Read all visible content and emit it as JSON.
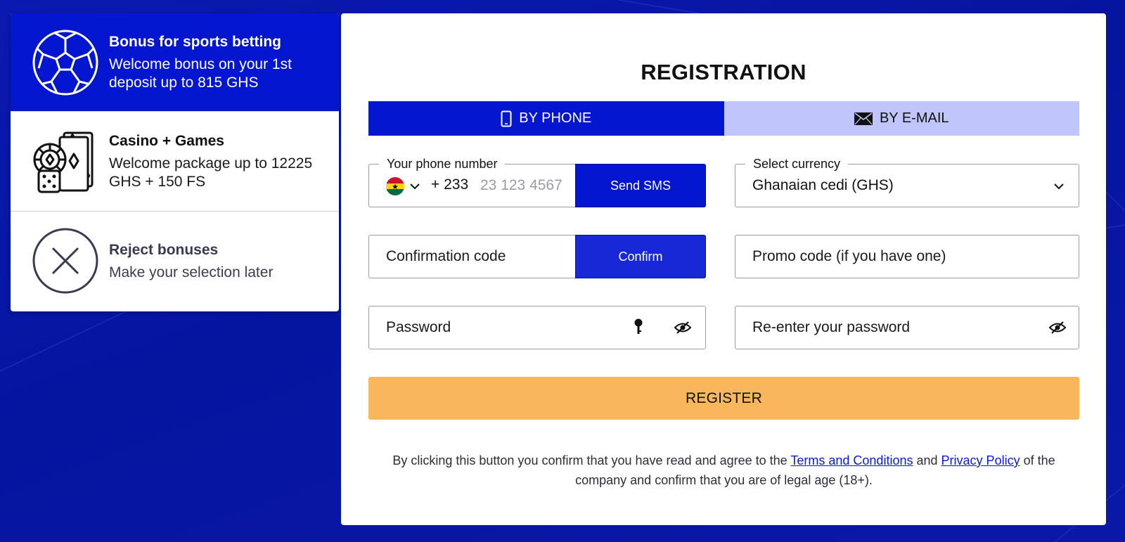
{
  "bonuses": {
    "items": [
      {
        "title": "Bonus for sports betting",
        "desc": "Welcome bonus on your 1st deposit up to 815 GHS",
        "icon": "soccer-ball-icon",
        "selected": true
      },
      {
        "title": "Casino + Games",
        "desc": "Welcome package up to 12225 GHS + 150 FS",
        "icon": "casino-cards-dice-icon",
        "selected": false
      },
      {
        "title": "Reject bonuses",
        "desc": "Make your selection later",
        "icon": "close-circle-icon",
        "selected": false
      }
    ]
  },
  "registration": {
    "title": "REGISTRATION",
    "tabs": [
      {
        "label": "BY PHONE",
        "icon": "mobile-phone-icon",
        "active": true
      },
      {
        "label": "BY E-MAIL",
        "icon": "envelope-icon",
        "active": false
      }
    ],
    "phone": {
      "legend": "Your phone number",
      "country": "ghana-flag-icon",
      "dial_code": "+ 233",
      "placeholder": "23 123 4567",
      "send_label": "Send SMS"
    },
    "currency": {
      "legend": "Select currency",
      "value": "Ghanaian cedi (GHS)"
    },
    "confirmation": {
      "placeholder": "Confirmation code",
      "confirm_label": "Confirm"
    },
    "promo": {
      "placeholder": "Promo code (if you have one)"
    },
    "password": {
      "placeholder": "Password"
    },
    "repassword": {
      "placeholder": "Re-enter your password"
    },
    "register_label": "REGISTER",
    "legal": {
      "part1": "By clicking this button you confirm that you have read and agree to the",
      "terms_link": "Terms and Conditions",
      "and": "and",
      "privacy_link": "Privacy Policy",
      "part2": "of the company and confirm that you are of legal age (18+)."
    }
  },
  "colors": {
    "primary": "#0416d0",
    "tab_inactive": "#c0c5fb",
    "register": "#f8b65d",
    "link": "#0a1bd6",
    "background": "#0615a0"
  }
}
